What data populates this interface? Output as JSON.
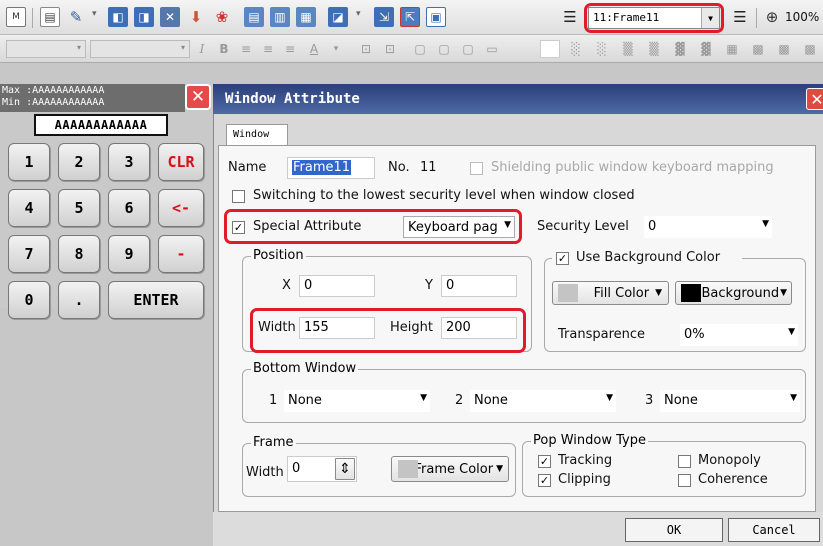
{
  "toolbar": {
    "frame_select": "11:Frame11",
    "zoom": "100%",
    "icons": [
      "new-window",
      "open",
      "tools",
      "window-layout",
      "copy-window",
      "delete-window",
      "export",
      "chart",
      "graph-a",
      "graph-b",
      "graph-c",
      "data",
      "import",
      "export-2",
      "list",
      "frame-prev",
      "frame-next",
      "zoom"
    ]
  },
  "keypad": {
    "max_label": "Max :AAAAAAAAAAAA",
    "min_label": "Min :AAAAAAAAAAAA",
    "display": "AAAAAAAAAAAA",
    "close": "✕",
    "keys": [
      "1",
      "2",
      "3",
      "CLR",
      "4",
      "5",
      "6",
      "<-",
      "7",
      "8",
      "9",
      "-",
      "0",
      ".",
      "ENTER"
    ]
  },
  "dialog": {
    "title": "Window Attribute",
    "close": "✕",
    "tab": "Window",
    "name_label": "Name",
    "name_value": "Frame11",
    "no_label": "No.",
    "no_value": "11",
    "shielding_label": "Shielding public window keyboard mapping",
    "switching_label": "Switching to the lowest security level when window closed",
    "special_label": "Special Attribute",
    "special_value": "Keyboard pag",
    "security_label": "Security Level",
    "security_value": "0",
    "position_group": "Position",
    "x_label": "X",
    "x_value": "0",
    "y_label": "Y",
    "y_value": "0",
    "width_label": "Width",
    "width_value": "155",
    "height_label": "Height",
    "height_value": "200",
    "use_bg_label": "Use Background Color",
    "fill_color": "Fill Color",
    "background": "Background",
    "transparence_label": "Transparence",
    "transparence_value": "0%",
    "bottom_group": "Bottom Window",
    "bw1_label": "1",
    "bw1_value": "None",
    "bw2_label": "2",
    "bw2_value": "None",
    "bw3_label": "3",
    "bw3_value": "None",
    "frame_group": "Frame",
    "frame_width_label": "Width",
    "frame_width_value": "0",
    "frame_color": "Frame Color",
    "pop_group": "Pop Window Type",
    "tracking": "Tracking",
    "monopoly": "Monopoly",
    "clipping": "Clipping",
    "coherence": "Coherence",
    "ok": "OK",
    "cancel": "Cancel"
  },
  "colors": {
    "highlight": "#e21b2a",
    "title_bar": "#2b3f7a",
    "key_red": "#d90e18"
  }
}
